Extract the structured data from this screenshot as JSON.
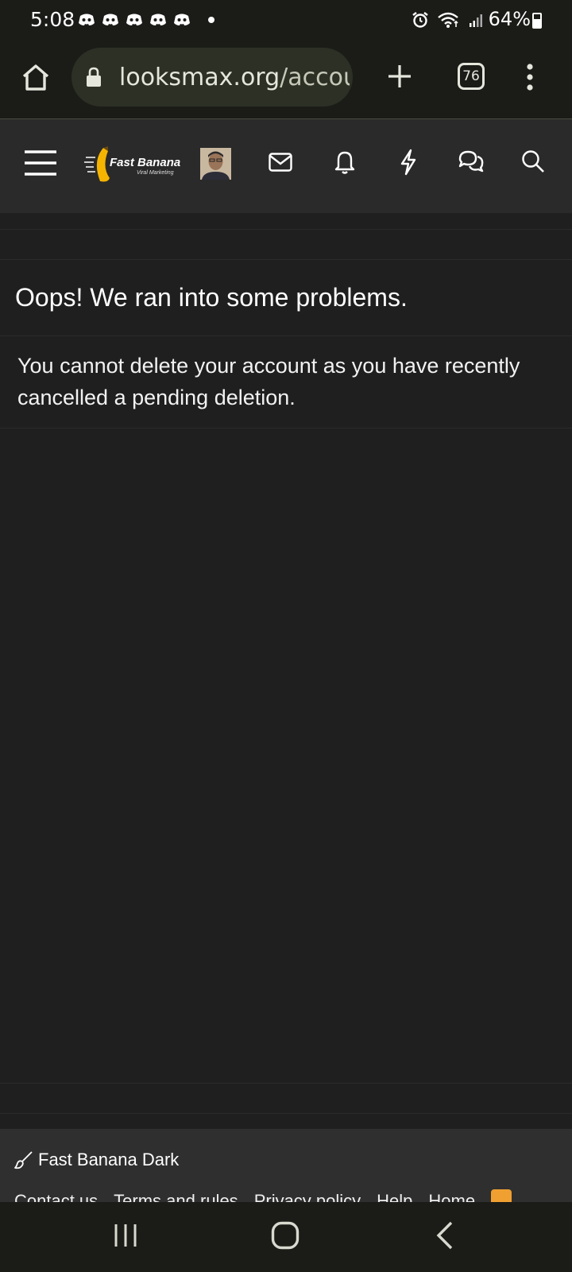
{
  "status_bar": {
    "time": "5:08",
    "battery_percent": "64%",
    "notification_icons": [
      "discord-icon",
      "discord-icon",
      "discord-icon",
      "discord-icon",
      "discord-icon"
    ]
  },
  "browser": {
    "url_domain": "looksmax.org",
    "url_path": "/accour",
    "tab_count": "76"
  },
  "site": {
    "logo_name": "Fast Banana",
    "logo_tagline": "Viral Marketing"
  },
  "error": {
    "title": "Oops! We ran into some problems.",
    "message": "You cannot delete your account as you have recently cancelled a pending deletion."
  },
  "footer": {
    "style_label": "Fast Banana Dark",
    "links": [
      "Contact us",
      "Terms and rules",
      "Privacy policy",
      "Help",
      "Home"
    ]
  },
  "colors": {
    "background": "#1f1f1f",
    "header": "#2a2a2a",
    "accent_banana": "#f5b400",
    "rss": "#f0a030"
  }
}
